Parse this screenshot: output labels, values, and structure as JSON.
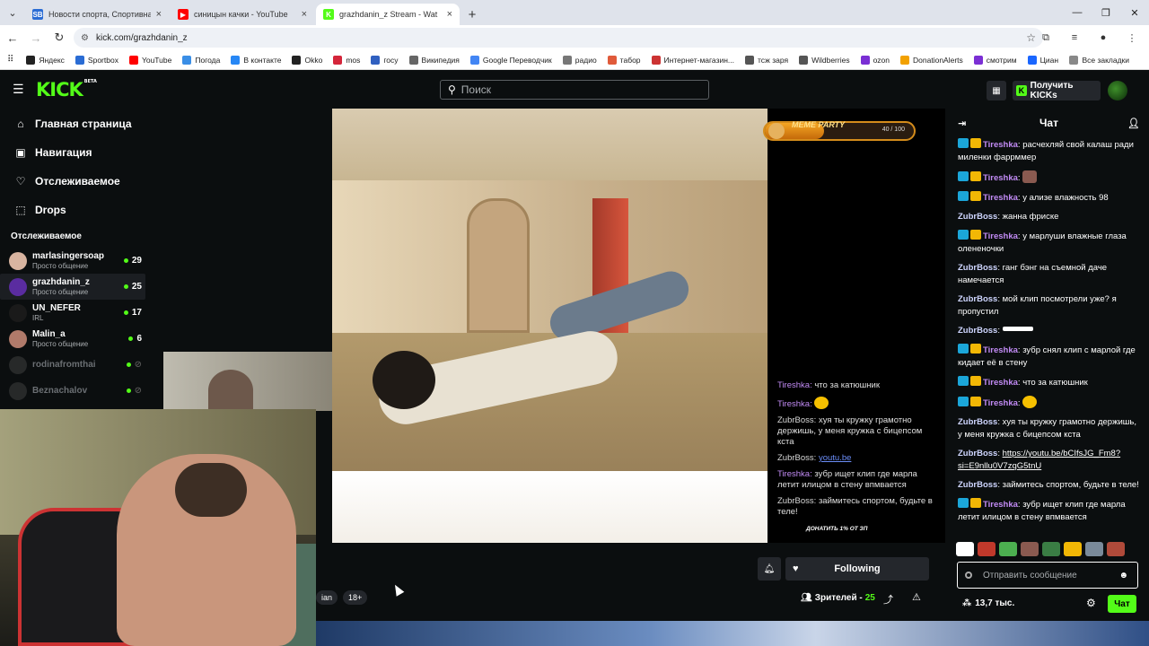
{
  "browser": {
    "tabs": [
      {
        "title": "Новости спорта, Спортивная н",
        "active": false,
        "color": "#2a6cd4",
        "letter": "SB"
      },
      {
        "title": "синицын качки - YouTube",
        "active": false,
        "color": "#ff0000",
        "letter": "▶"
      },
      {
        "title": "grazhdanin_z Stream - Wat",
        "active": true,
        "color": "#53fc18",
        "letter": "K"
      }
    ],
    "url": "kick.com/grazhdanin_z",
    "bookmarks": [
      {
        "label": "Яндекс",
        "color": "#222"
      },
      {
        "label": "Sportbox",
        "color": "#2a6cd4"
      },
      {
        "label": "YouTube",
        "color": "#ff0000"
      },
      {
        "label": "Погода",
        "color": "#3a8ee6"
      },
      {
        "label": "В контакте",
        "color": "#2787f5"
      },
      {
        "label": "Okko",
        "color": "#222"
      },
      {
        "label": "mos",
        "color": "#d4253a"
      },
      {
        "label": "госу",
        "color": "#3060c0"
      },
      {
        "label": "Википедия",
        "color": "#666"
      },
      {
        "label": "Google Переводчик",
        "color": "#4285f4"
      },
      {
        "label": "радио",
        "color": "#777"
      },
      {
        "label": "табор",
        "color": "#e05a3a"
      },
      {
        "label": "Интернет-магазин...",
        "color": "#c33"
      },
      {
        "label": "тсж заря",
        "color": "#555"
      },
      {
        "label": "Wildberries",
        "color": "#555"
      },
      {
        "label": "ozon",
        "color": "#7a2fd4"
      },
      {
        "label": "DonationAlerts",
        "color": "#f2a100"
      },
      {
        "label": "смотрим",
        "color": "#7b2fd4"
      },
      {
        "label": "Циан",
        "color": "#1a66ff"
      }
    ],
    "all_bookmarks": "Все закладки"
  },
  "header": {
    "logo": "KICK",
    "logo_beta": "BETA",
    "search_placeholder": "Поиск",
    "get_kicks": "Получить KICKs"
  },
  "sidebar": {
    "nav": [
      {
        "label": "Главная страница",
        "icon": "home-icon",
        "glyph": "⌂"
      },
      {
        "label": "Навигация",
        "icon": "browse-icon",
        "glyph": "▣"
      },
      {
        "label": "Отслеживаемое",
        "icon": "heart-icon",
        "glyph": "♡"
      },
      {
        "label": "Drops",
        "icon": "drops-icon",
        "glyph": "⬚"
      }
    ],
    "following_title": "Отслеживаемое",
    "channels": [
      {
        "name": "marlasingersoap",
        "sub": "Просто общение",
        "count": "29",
        "color": "#d8b4a0",
        "live": true
      },
      {
        "name": "grazhdanin_z",
        "sub": "Просто общение",
        "count": "25",
        "color": "#5a2ca0",
        "live": true
      },
      {
        "name": "UN_NEFER",
        "sub": "IRL",
        "count": "17",
        "color": "#1a1a1a",
        "live": true
      },
      {
        "name": "Malin_a",
        "sub": "Просто общение",
        "count": "6",
        "color": "#b07a6a",
        "live": true
      },
      {
        "name": "rodinafromthai",
        "sub": "",
        "count": "",
        "color": "#444",
        "live": false
      },
      {
        "name": "Beznachalov",
        "sub": "",
        "count": "",
        "color": "#444",
        "live": false
      }
    ]
  },
  "player": {
    "meme_label": "MEME PARTY",
    "meme_count": "40 / 100",
    "meme_progress": 0.4,
    "overlay_chat": [
      {
        "user": "Tireshka",
        "text": "что за катюшник",
        "style": "u1"
      },
      {
        "user": "Tireshka",
        "text": "",
        "emoji": true,
        "style": "u1"
      },
      {
        "user": "ZubrBoss",
        "text": "хуя ты кружку грамотно держишь, у меня кружка с бицепсом кста",
        "style": "u2"
      },
      {
        "user": "ZubrBoss",
        "text": "youtu.be",
        "link": true,
        "style": "u2"
      },
      {
        "user": "Tireshka",
        "text": "зубр ищет клип где марла летит илицом в стену впмвается",
        "style": "u1"
      },
      {
        "user": "ZubrBoss",
        "text": "займитесь спортом, будьте в теле!",
        "style": "u2"
      }
    ],
    "donate_text": "ДОНАТИТЬ 1% ОТ ЗП"
  },
  "stream_info": {
    "tags": [
      "ian",
      "18+"
    ],
    "following_label": "Following",
    "viewers_label": "Зрителей -",
    "viewers_count": "25"
  },
  "chat": {
    "title": "Чат",
    "messages": [
      {
        "user": "Tireshka",
        "badges": true,
        "text": "расчехляй свой калаш ради миленки фаррммер"
      },
      {
        "user": "Tireshka",
        "badges": true,
        "text": "",
        "emote": "a"
      },
      {
        "user": "Tireshka",
        "badges": true,
        "text": "у ализе влажность 98"
      },
      {
        "user": "ZubrBoss",
        "badges": false,
        "text": "жанна фриске"
      },
      {
        "user": "Tireshka",
        "badges": true,
        "text": "у марлуши влажные глаза олененочки"
      },
      {
        "user": "ZubrBoss",
        "badges": false,
        "text": "ганг бэнг на съемной даче намечается"
      },
      {
        "user": "ZubrBoss",
        "badges": false,
        "text": "мой клип посмотрели уже? я пропустил"
      },
      {
        "user": "ZubrBoss",
        "badges": false,
        "text": "",
        "emote": "b"
      },
      {
        "user": "Tireshka",
        "badges": true,
        "text": "зубр снял клип с марлой где кидает её в стену"
      },
      {
        "user": "Tireshka",
        "badges": true,
        "text": "что за катюшник"
      },
      {
        "user": "Tireshka",
        "badges": true,
        "text": "",
        "emote": "c"
      },
      {
        "user": "ZubrBoss",
        "badges": false,
        "text": "хуя ты кружку грамотно держишь, у меня кружка с бицепсом кста"
      },
      {
        "user": "ZubrBoss",
        "badges": false,
        "text": "https://youtu.be/bCIfsJG_Fm8?si=E9nllu0V7zqG5tnU",
        "link": true
      },
      {
        "user": "ZubrBoss",
        "badges": false,
        "text": "займитесь спортом, будьте в теле!"
      },
      {
        "user": "Tireshka",
        "badges": true,
        "text": "зубр ищет клип где марла летит илицом в стену впмвается"
      }
    ],
    "emote_colors": [
      "#fff",
      "#c0392b",
      "#4caf50",
      "#8a5a50",
      "#3a7d44",
      "#f2b705",
      "#7a8a9a",
      "#b04a3a"
    ],
    "input_placeholder": "Отправить сообщение",
    "kicks_count": "13,7 тыс.",
    "send_label": "Чат"
  }
}
